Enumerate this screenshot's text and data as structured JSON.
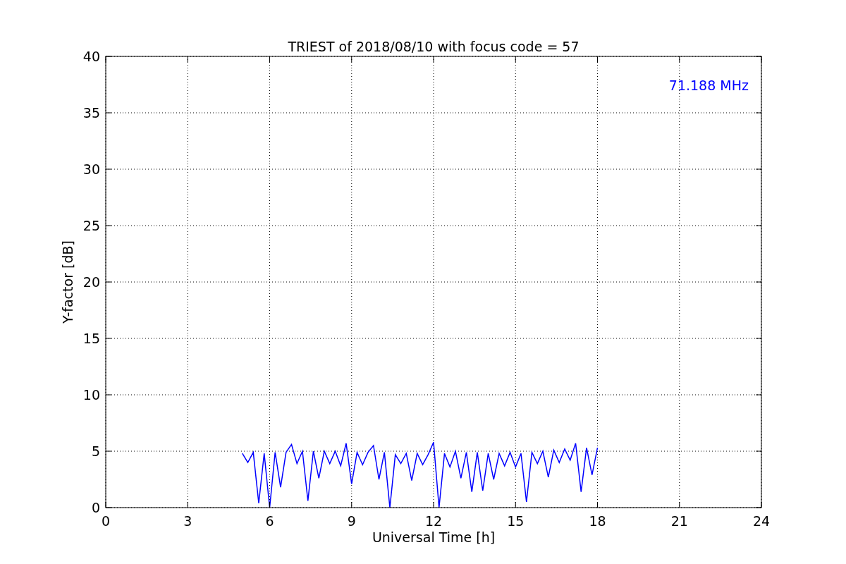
{
  "chart_data": {
    "type": "line",
    "title": "TRIEST of 2018/08/10 with focus code = 57",
    "xlabel": "Universal Time [h]",
    "ylabel": "Y-factor [dB]",
    "xlim": [
      0,
      24
    ],
    "ylim": [
      0,
      40
    ],
    "xticks": [
      0,
      3,
      6,
      9,
      12,
      15,
      18,
      21,
      24
    ],
    "yticks": [
      0,
      5,
      10,
      15,
      20,
      25,
      30,
      35,
      40
    ],
    "x": [
      5.0,
      5.2,
      5.4,
      5.6,
      5.8,
      6.0,
      6.2,
      6.4,
      6.6,
      6.8,
      7.0,
      7.2,
      7.4,
      7.6,
      7.8,
      8.0,
      8.2,
      8.4,
      8.6,
      8.8,
      9.0,
      9.2,
      9.4,
      9.6,
      9.8,
      10.0,
      10.2,
      10.4,
      10.6,
      10.8,
      11.0,
      11.2,
      11.4,
      11.6,
      11.8,
      12.0,
      12.2,
      12.4,
      12.6,
      12.8,
      13.0,
      13.2,
      13.4,
      13.6,
      13.8,
      14.0,
      14.2,
      14.4,
      14.6,
      14.8,
      15.0,
      15.2,
      15.4,
      15.6,
      15.8,
      16.0,
      16.2,
      16.4,
      16.6,
      16.8,
      17.0,
      17.2,
      17.4,
      17.6,
      17.8,
      18.0
    ],
    "series": [
      {
        "name": "71.188 MHz",
        "color": "#0000ff",
        "values": [
          4.8,
          4.0,
          4.9,
          0.4,
          4.8,
          0.0,
          4.9,
          1.8,
          4.9,
          5.6,
          3.9,
          5.0,
          0.6,
          5.0,
          2.6,
          5.0,
          3.9,
          5.0,
          3.7,
          5.7,
          2.1,
          4.9,
          3.8,
          4.9,
          5.5,
          2.5,
          4.9,
          0.0,
          4.7,
          3.9,
          4.8,
          2.4,
          4.8,
          3.8,
          4.7,
          5.8,
          0.0,
          4.8,
          3.6,
          5.0,
          2.6,
          4.9,
          1.4,
          4.9,
          1.5,
          4.8,
          2.5,
          4.8,
          3.7,
          4.9,
          3.6,
          4.8,
          0.5,
          4.9,
          3.9,
          5.0,
          2.7,
          5.1,
          4.0,
          5.2,
          4.2,
          5.7,
          1.4,
          5.3,
          2.9,
          5.3
        ]
      }
    ],
    "grid": true
  }
}
